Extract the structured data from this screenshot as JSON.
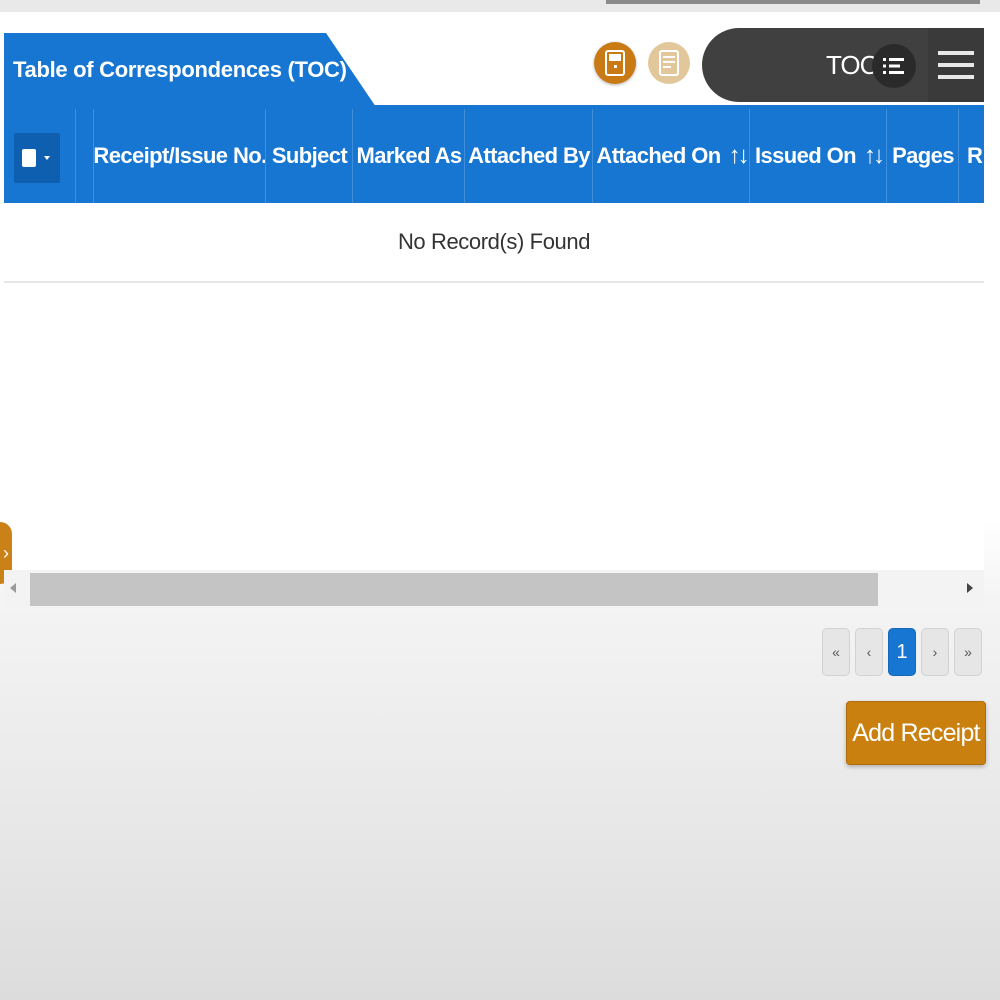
{
  "panel": {
    "title": "Table of Correspondences (TOC)"
  },
  "toolbar": {
    "icon_1": "document-icon",
    "icon_2": "notes-icon",
    "toc_label": "TOC",
    "toc_list_icon": "list-icon",
    "menu_icon": "hamburger-icon"
  },
  "table": {
    "columns": [
      {
        "label": "Receipt/Issue No.",
        "sortable": false
      },
      {
        "label": "Subject",
        "sortable": false
      },
      {
        "label": "Marked As",
        "sortable": false
      },
      {
        "label": "Attached By",
        "sortable": false
      },
      {
        "label": "Attached On",
        "sortable": true
      },
      {
        "label": "Issued On",
        "sortable": true
      },
      {
        "label": "Pages",
        "sortable": false
      },
      {
        "label": "R",
        "sortable": false
      }
    ],
    "empty_message": "No Record(s) Found"
  },
  "pager": {
    "first": "«",
    "prev": "‹",
    "current": "1",
    "next": "›",
    "last": "»"
  },
  "actions": {
    "add_receipt": "Add Receipt",
    "side_toggle": "›"
  },
  "colors": {
    "primary_blue": "#1676d2",
    "accent_orange": "#c9800f",
    "toolbar_dark": "#404040"
  }
}
